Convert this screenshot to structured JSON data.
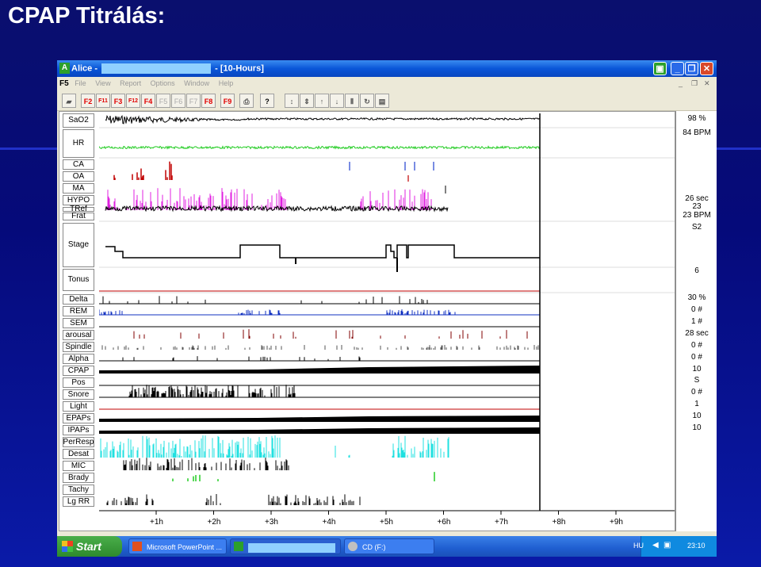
{
  "slide": {
    "title": "CPAP Titrálás:"
  },
  "window": {
    "app_letter": "A",
    "title_prefix": "Alice -",
    "title_suffix": "- [10-Hours]",
    "buttons": {
      "minimize": "_",
      "restore": "❐",
      "close": "✕"
    }
  },
  "menu": {
    "logo": "F5",
    "items": [
      "File",
      "View",
      "Report",
      "Options",
      "Window",
      "Help"
    ]
  },
  "toolbar": {
    "buttons": [
      {
        "label": "F2",
        "enabled": true
      },
      {
        "label": "F11",
        "enabled": true
      },
      {
        "label": "F3",
        "enabled": true
      },
      {
        "label": "F12",
        "enabled": true
      },
      {
        "label": "F4",
        "enabled": true
      },
      {
        "label": "F5",
        "enabled": false
      },
      {
        "label": "F6",
        "enabled": false
      },
      {
        "label": "F7",
        "enabled": false
      },
      {
        "label": "F8",
        "enabled": true
      },
      {
        "label": "F9",
        "enabled": true
      }
    ]
  },
  "channels": [
    {
      "label": "SaO2",
      "value": "98 %"
    },
    {
      "label": "HR",
      "value": "84 BPM"
    },
    {
      "label": "CA",
      "value": ""
    },
    {
      "label": "OA",
      "value": ""
    },
    {
      "label": "MA",
      "value": ""
    },
    {
      "label": "HYPO",
      "value": "26 sec"
    },
    {
      "label": "TRef",
      "value": "23"
    },
    {
      "label": "Frat",
      "value": "23 BPM"
    },
    {
      "label": "Stage",
      "value": "S2"
    },
    {
      "label": "Tonus",
      "value": "6"
    },
    {
      "label": "Delta",
      "value": "30 %"
    },
    {
      "label": "REM",
      "value": "0 #"
    },
    {
      "label": "SEM",
      "value": "1 #"
    },
    {
      "label": "arousal",
      "value": "28 sec"
    },
    {
      "label": "Spindle",
      "value": "0 #"
    },
    {
      "label": "Alpha",
      "value": "0 #"
    },
    {
      "label": "CPAP",
      "value": "10"
    },
    {
      "label": "Pos",
      "value": "S"
    },
    {
      "label": "Snore",
      "value": "0 #"
    },
    {
      "label": "Light",
      "value": "1"
    },
    {
      "label": "EPAPs",
      "value": "10"
    },
    {
      "label": "IPAPs",
      "value": "10"
    },
    {
      "label": "PerResp",
      "value": ""
    },
    {
      "label": "Desat",
      "value": ""
    },
    {
      "label": "MIC",
      "value": ""
    },
    {
      "label": "Brady",
      "value": ""
    },
    {
      "label": "Tachy",
      "value": ""
    },
    {
      "label": "Lg RR",
      "value": ""
    }
  ],
  "time_axis": [
    "+1h",
    "+2h",
    "+3h",
    "+4h",
    "+5h",
    "+6h",
    "+7h",
    "+8h",
    "+9h"
  ],
  "colors": {
    "spo2": "#000000",
    "hr": "#22cc22",
    "ca": "#2040d0",
    "oa": "#c00000",
    "hypo": "#e020e0",
    "rem": "#1030c0",
    "desat": "#20e0e0",
    "brady": "#22cc22",
    "arousal": "#800000"
  },
  "taskbar": {
    "start": "Start",
    "tasks": [
      "Microsoft PowerPoint ...",
      "",
      "CD (F:)"
    ],
    "lang": "HU",
    "clock": "23:10"
  }
}
